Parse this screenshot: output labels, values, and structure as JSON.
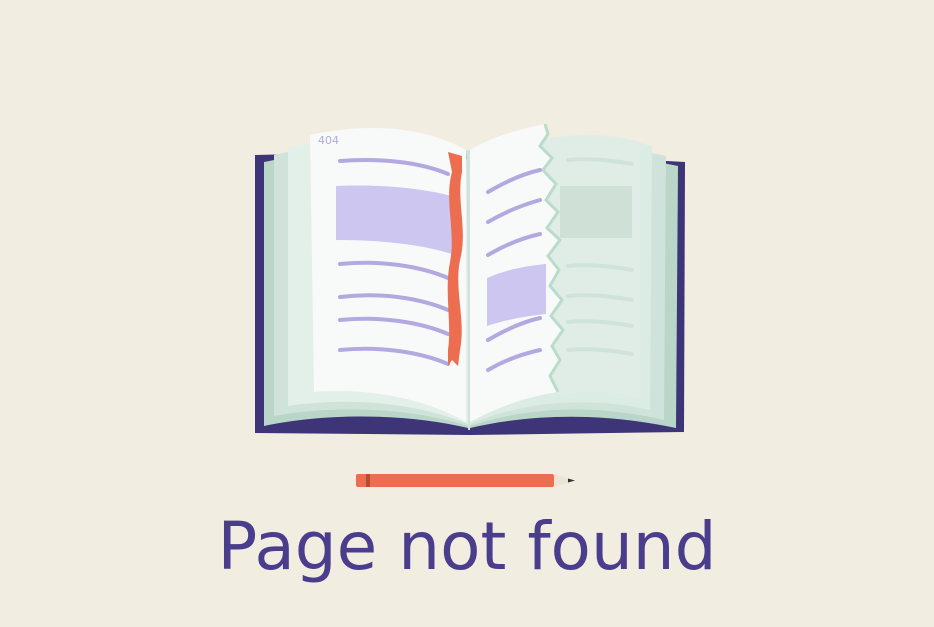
{
  "page": {
    "headline": "Page not found",
    "page_number": "404"
  },
  "colors": {
    "background": "#f1ede1",
    "headline": "#4a3d8c",
    "book_cover": "#3e3478",
    "page_light": "#f7faf8",
    "page_shade": "#dbece4",
    "page_deep": "#b9d6c8",
    "text_line": "#b3a8e0",
    "highlight": "#cdc6f0",
    "bookmark": "#ec6d4f",
    "torn_page": "#e0ede7"
  },
  "icons": {
    "book": "open-book-illustration",
    "bookmark": "bookmark-ribbon",
    "pencil": "pencil-icon"
  }
}
